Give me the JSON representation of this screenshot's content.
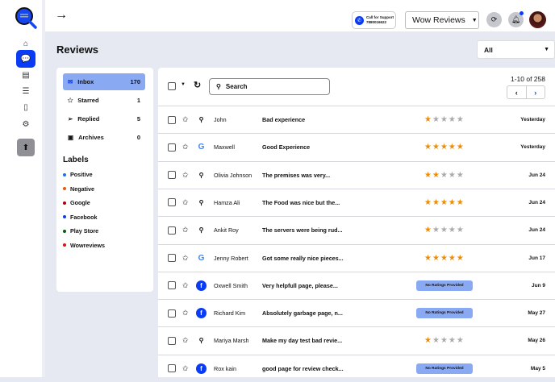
{
  "topbar": {
    "support_label": "Call for Support",
    "support_phone": "7880016622",
    "business": "Wow Reviews"
  },
  "page": {
    "title": "Reviews",
    "filter": "All"
  },
  "folders": [
    {
      "label": "Inbox",
      "count": "170"
    },
    {
      "label": "Starred",
      "count": "1"
    },
    {
      "label": "Replied",
      "count": "5"
    },
    {
      "label": "Archives",
      "count": "0"
    }
  ],
  "labels_heading": "Labels",
  "labels": [
    {
      "label": "Positive",
      "color": "#1a73e8"
    },
    {
      "label": "Negative",
      "color": "#e8590c"
    },
    {
      "label": "Google",
      "color": "#b00000"
    },
    {
      "label": "Facebook",
      "color": "#0b3cf5"
    },
    {
      "label": "Play Store",
      "color": "#0b5a1a"
    },
    {
      "label": "Wowreviews",
      "color": "#e01010"
    }
  ],
  "toolbar": {
    "search_label": "Search",
    "pagination": "1-10 of 258"
  },
  "no_rating_label": "No Ratings Provided",
  "reviews": [
    {
      "source": "wowreviews",
      "name": "John",
      "subject": "Bad experience",
      "rating": 1,
      "date": "Yesterday"
    },
    {
      "source": "google",
      "name": "Maxwell",
      "subject": "Good Experience",
      "rating": 5,
      "date": "Yesterday"
    },
    {
      "source": "wowreviews",
      "name": "Olivia Johnson",
      "subject": "The premises was very...",
      "rating": 2,
      "date": "Jun 24"
    },
    {
      "source": "wowreviews",
      "name": "Hamza Ali",
      "subject": "The Food was nice but the...",
      "rating": 5,
      "date": "Jun 24"
    },
    {
      "source": "wowreviews",
      "name": "Ankit Roy",
      "subject": "The servers were being rud...",
      "rating": 1,
      "date": "Jun 24"
    },
    {
      "source": "google",
      "name": "Jenny Robert",
      "subject": "Got some really nice pieces...",
      "rating": 5,
      "date": "Jun 17"
    },
    {
      "source": "facebook",
      "name": "Oxwell Smith",
      "subject": "Very helpfull page, please...",
      "rating": null,
      "date": "Jun 9"
    },
    {
      "source": "facebook",
      "name": "Richard Kim",
      "subject": "Absolutely garbage page, n...",
      "rating": null,
      "date": "May 27"
    },
    {
      "source": "wowreviews",
      "name": "Mariya Marsh",
      "subject": "Make my day test bad revie...",
      "rating": 1,
      "date": "May 26"
    },
    {
      "source": "facebook",
      "name": "Rox kain",
      "subject": "good page for review check...",
      "rating": null,
      "date": "May 5"
    }
  ]
}
